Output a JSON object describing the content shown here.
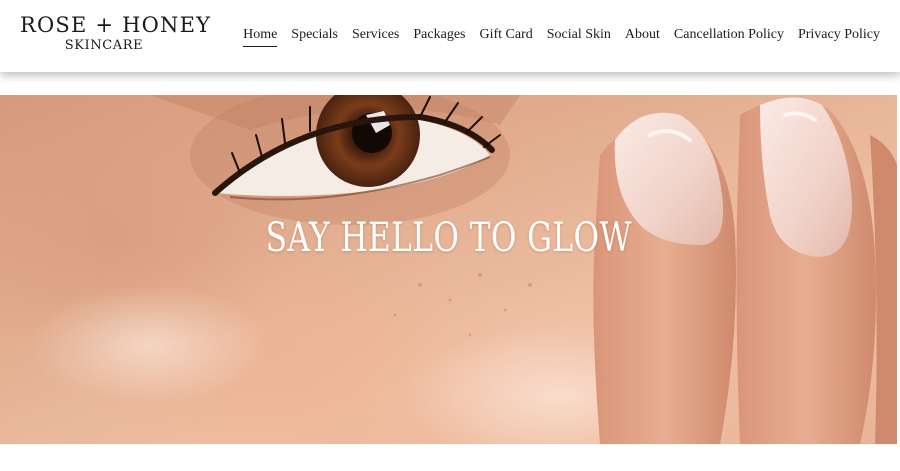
{
  "brand": {
    "name_line1": "ROSE + HONEY",
    "name_line2": "SKINCARE"
  },
  "nav": {
    "items": [
      {
        "label": "Home",
        "active": true
      },
      {
        "label": "Specials",
        "active": false
      },
      {
        "label": "Services",
        "active": false
      },
      {
        "label": "Packages",
        "active": false
      },
      {
        "label": "Gift Card",
        "active": false
      },
      {
        "label": "Social Skin",
        "active": false
      },
      {
        "label": "About",
        "active": false
      },
      {
        "label": "Cancellation Policy",
        "active": false
      },
      {
        "label": "Privacy Policy",
        "active": false
      }
    ]
  },
  "hero": {
    "title": "SAY HELLO TO GLOW",
    "image": "close-up-eye-and-fingertips-photo"
  },
  "colors": {
    "text": "#1c1c1c",
    "header_bg": "#ffffff",
    "skin_tone": "#e2ad8f",
    "iris": "#6b3318"
  }
}
